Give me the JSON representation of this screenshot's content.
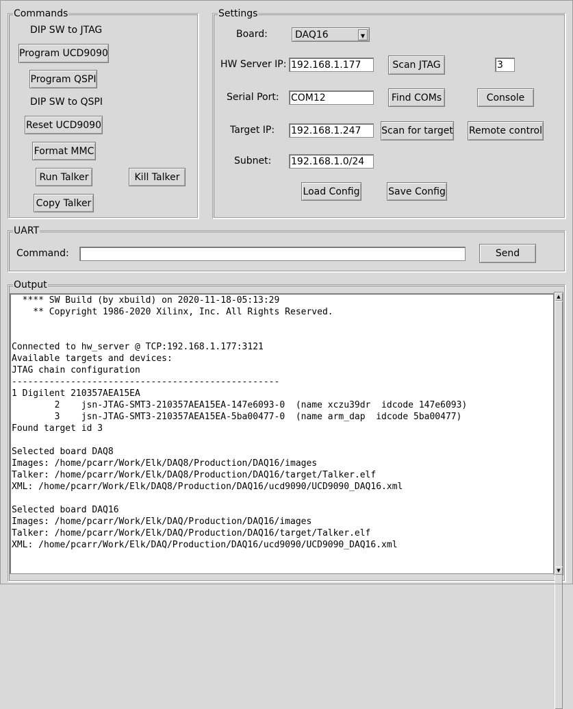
{
  "commands": {
    "title": "Commands",
    "dip_jtag": "DIP SW to JTAG",
    "program_ucd": "Program UCD9090",
    "program_qspi": "Program QSPI",
    "dip_qspi": "DIP SW to QSPI",
    "reset_ucd": "Reset UCD9090",
    "format_mmc": "Format MMC",
    "run_talker": "Run Talker",
    "kill_talker": "Kill Talker",
    "copy_talker": "Copy Talker"
  },
  "settings": {
    "title": "Settings",
    "board_label": "Board:",
    "board_value": "DAQ16",
    "hw_server_label": "HW Server IP:",
    "hw_server_value": "192.168.1.177",
    "scan_jtag": "Scan JTAG",
    "target_id_value": "3",
    "serial_label": "Serial Port:",
    "serial_value": "COM12",
    "find_coms": "Find COMs",
    "console": "Console",
    "target_ip_label": "Target IP:",
    "target_ip_value": "192.168.1.247",
    "scan_target": "Scan for target",
    "remote_control": "Remote control",
    "subnet_label": "Subnet:",
    "subnet_value": "192.168.1.0/24",
    "load_config": "Load Config",
    "save_config": "Save Config"
  },
  "uart": {
    "title": "UART",
    "command_label": "Command:",
    "command_value": "",
    "send": "Send"
  },
  "output": {
    "title": "Output",
    "lines": [
      "  **** SW Build (by xbuild) on 2020-11-18-05:13:29",
      "    ** Copyright 1986-2020 Xilinx, Inc. All Rights Reserved.",
      "",
      "",
      "Connected to hw_server @ TCP:192.168.1.177:3121",
      "Available targets and devices:",
      "JTAG chain configuration",
      "--------------------------------------------------",
      "1 Digilent 210357AEA15EA",
      "        2    jsn-JTAG-SMT3-210357AEA15EA-147e6093-0  (name xczu39dr  idcode 147e6093)",
      "        3    jsn-JTAG-SMT3-210357AEA15EA-5ba00477-0  (name arm_dap  idcode 5ba00477)",
      "Found target id 3",
      "",
      "Selected board DAQ8",
      "Images: /home/pcarr/Work/Elk/DAQ8/Production/DAQ16/images",
      "Talker: /home/pcarr/Work/Elk/DAQ8/Production/DAQ16/target/Talker.elf",
      "XML: /home/pcarr/Work/Elk/DAQ8/Production/DAQ16/ucd9090/UCD9090_DAQ16.xml",
      "",
      "Selected board DAQ16",
      "Images: /home/pcarr/Work/Elk/DAQ/Production/DAQ16/images",
      "Talker: /home/pcarr/Work/Elk/DAQ/Production/DAQ16/target/Talker.elf",
      "XML: /home/pcarr/Work/Elk/DAQ/Production/DAQ16/ucd9090/UCD9090_DAQ16.xml"
    ]
  },
  "icons": {
    "combo_arrow": "chevron-down-icon",
    "scroll_up": "arrow-up-icon",
    "scroll_down": "arrow-down-icon"
  }
}
